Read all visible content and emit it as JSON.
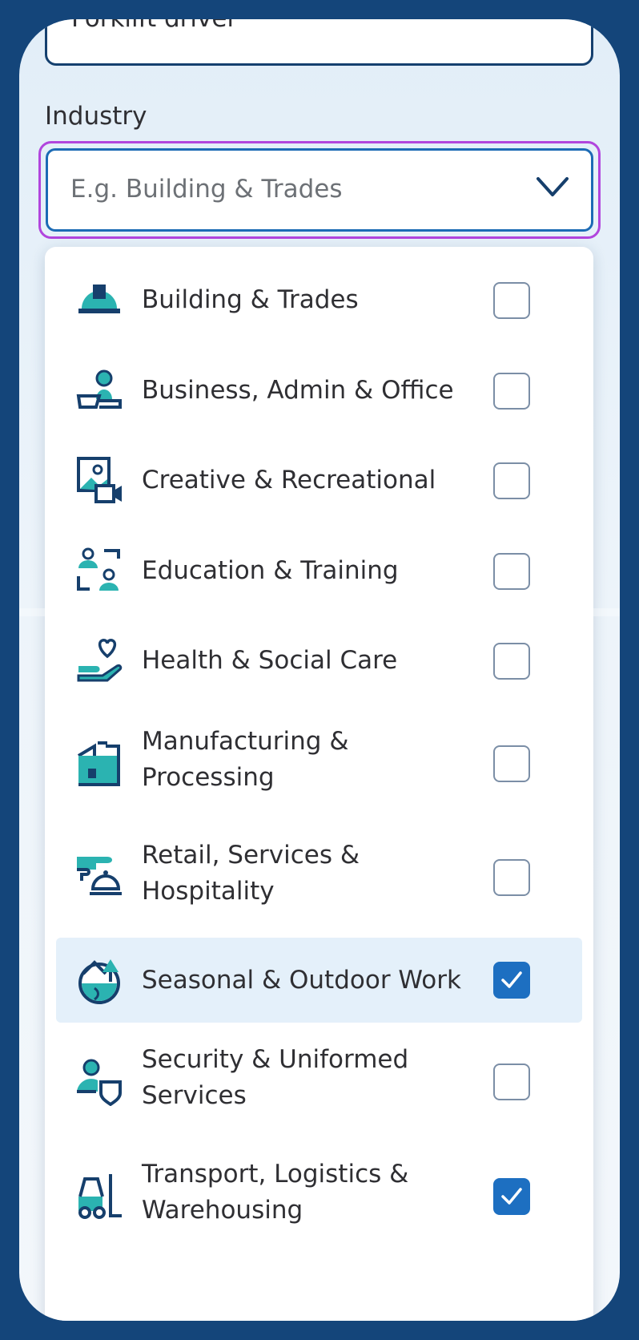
{
  "previous_field": {
    "value": "Forklift driver"
  },
  "industry": {
    "label": "Industry",
    "placeholder": "E.g. Building & Trades",
    "options": [
      {
        "label": "Building & Trades",
        "icon": "hard-hat-icon",
        "checked": false
      },
      {
        "label": "Business, Admin & Office",
        "icon": "office-worker-icon",
        "checked": false
      },
      {
        "label": "Creative & Recreational",
        "icon": "media-camera-icon",
        "checked": false
      },
      {
        "label": "Education & Training",
        "icon": "teacher-student-icon",
        "checked": false
      },
      {
        "label": "Health & Social Care",
        "icon": "heart-hand-icon",
        "checked": false
      },
      {
        "label": "Manufacturing & Processing",
        "icon": "factory-icon",
        "checked": false
      },
      {
        "label": "Retail, Services & Hospitality",
        "icon": "service-bell-icon",
        "checked": false
      },
      {
        "label": "Seasonal & Outdoor Work",
        "icon": "globe-tree-icon",
        "checked": true
      },
      {
        "label": "Security & Uniformed Services",
        "icon": "person-shield-icon",
        "checked": false
      },
      {
        "label": "Transport, Logistics & Warehousing",
        "icon": "forklift-icon",
        "checked": true
      }
    ]
  },
  "colors": {
    "frame": "#14457a",
    "focus_ring": "#b145dd",
    "field_border": "#1c6bb5",
    "checkbox_checked": "#1d6fc1",
    "selected_row": "#e4f0fa",
    "icon_teal": "#2bb3b1",
    "icon_navy": "#163f6c"
  }
}
